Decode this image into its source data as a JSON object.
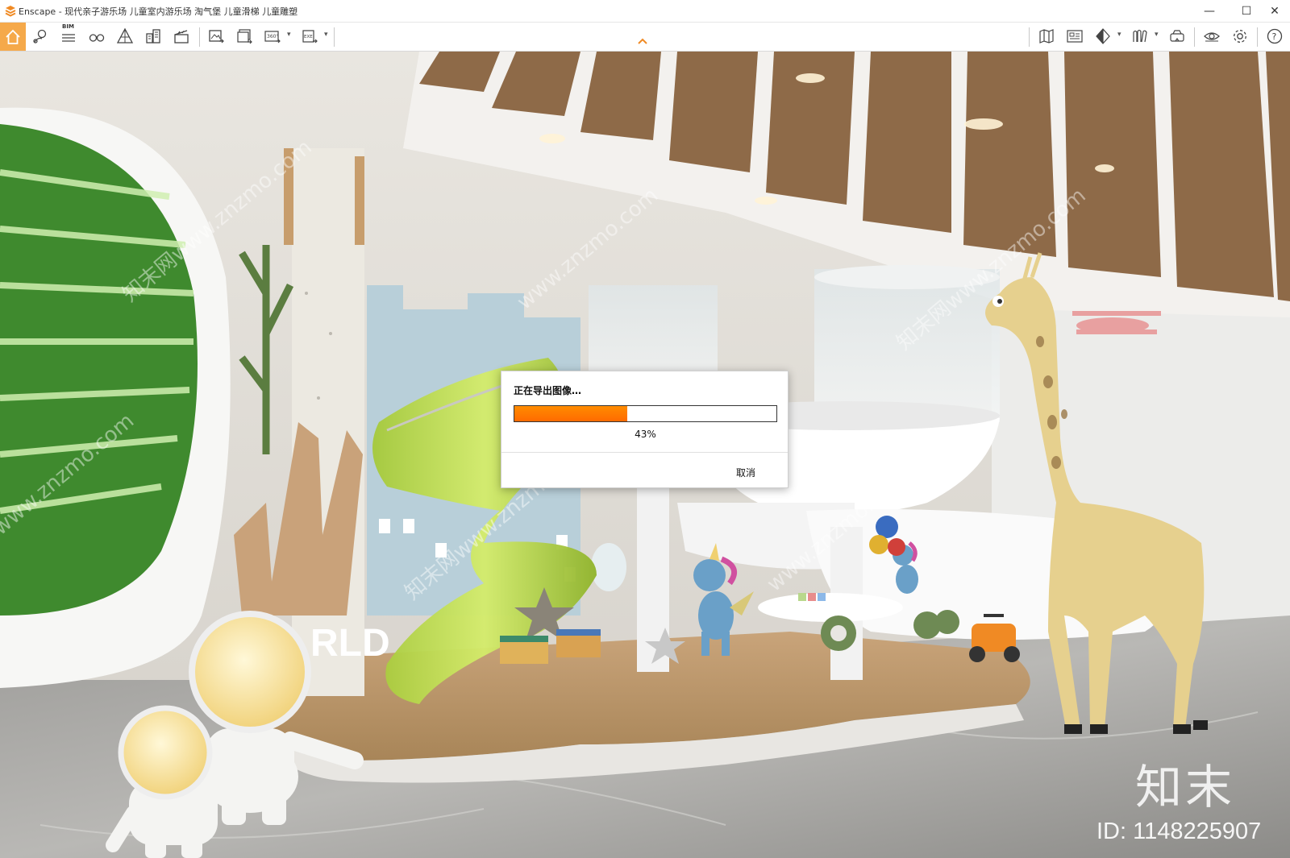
{
  "window": {
    "title": "Enscape - 现代亲子游乐场 儿童室内游乐场 淘气堡 儿童滑梯 儿童雕塑",
    "controls": {
      "minimize": "—",
      "maximize": "☐",
      "close": "✕"
    }
  },
  "toolbar": {
    "accent_color": "#f5a94a",
    "bim_label": "BIM",
    "left_tools": [
      "home-icon",
      "map-pin-icon",
      "bim-icon",
      "binoculars-icon",
      "perspective-icon",
      "buildings-icon",
      "clapperboard-icon",
      "screenshot-icon",
      "batch-render-icon",
      "panorama-360-icon",
      "export-exe-icon"
    ],
    "right_tools": [
      "map-icon",
      "asset-library-icon",
      "view-cube-icon",
      "books-icon",
      "vr-headset-icon",
      "visual-settings-icon",
      "settings-icon",
      "help-icon"
    ],
    "panorama_label": "360°",
    "exe_label": "EXE"
  },
  "dialog": {
    "title": "正在导出图像…",
    "progress": 0.43,
    "progress_text": "43%",
    "cancel_label": "取消",
    "progress_color": "#ff7a00"
  },
  "watermark": {
    "logo": "知末",
    "id_text": "ID: 1148225907",
    "pattern": [
      "知末网www.znzmo.com",
      "www.znzmo.com",
      "知末网www.znzmo.com",
      "www.znzmo.com",
      "知末网www.znzmo.com",
      "www.znzmo.com"
    ]
  },
  "scene": {
    "sign_text": "RLD"
  }
}
